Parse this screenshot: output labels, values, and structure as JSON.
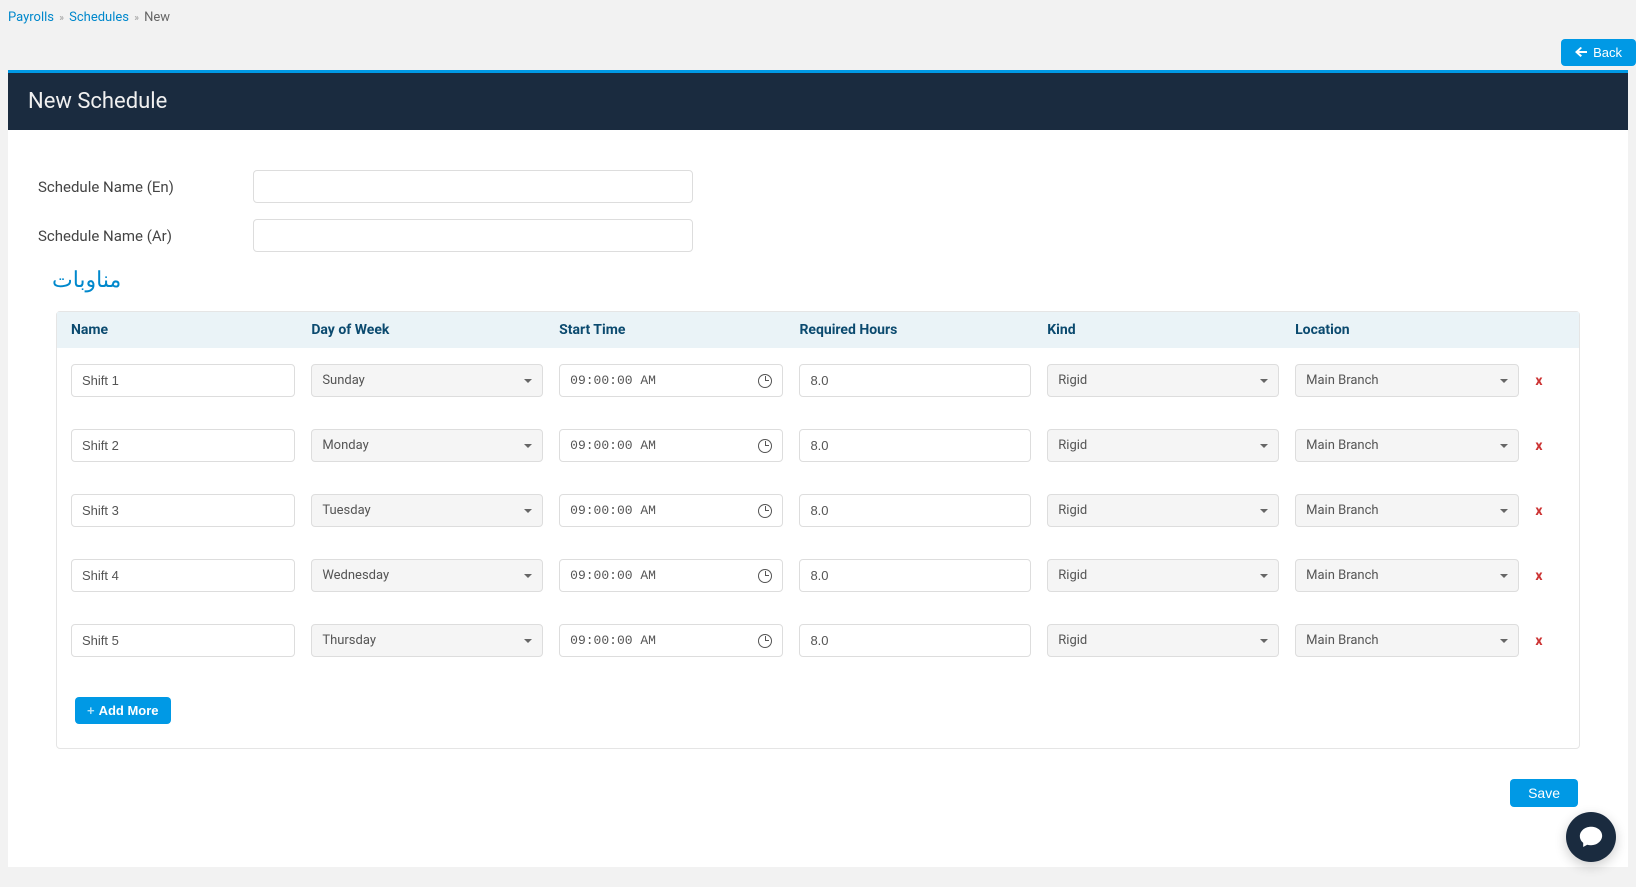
{
  "breadcrumb": {
    "payrolls": "Payrolls",
    "schedules": "Schedules",
    "current": "New"
  },
  "header": {
    "back": "Back",
    "title": "New Schedule"
  },
  "form": {
    "name_en_label": "Schedule Name (En)",
    "name_en_value": "",
    "name_ar_label": "Schedule Name (Ar)",
    "name_ar_value": "",
    "section_title": "مناوبات"
  },
  "table": {
    "headers": {
      "name": "Name",
      "day": "Day of Week",
      "start": "Start Time",
      "hours": "Required Hours",
      "kind": "Kind",
      "location": "Location"
    },
    "rows": [
      {
        "name": "Shift 1",
        "day": "Sunday",
        "start": "09:00:00 AM",
        "hours": "8.0",
        "kind": "Rigid",
        "location": "Main Branch"
      },
      {
        "name": "Shift 2",
        "day": "Monday",
        "start": "09:00:00 AM",
        "hours": "8.0",
        "kind": "Rigid",
        "location": "Main Branch"
      },
      {
        "name": "Shift 3",
        "day": "Tuesday",
        "start": "09:00:00 AM",
        "hours": "8.0",
        "kind": "Rigid",
        "location": "Main Branch"
      },
      {
        "name": "Shift 4",
        "day": "Wednesday",
        "start": "09:00:00 AM",
        "hours": "8.0",
        "kind": "Rigid",
        "location": "Main Branch"
      },
      {
        "name": "Shift 5",
        "day": "Thursday",
        "start": "09:00:00 AM",
        "hours": "8.0",
        "kind": "Rigid",
        "location": "Main Branch"
      }
    ],
    "delete_label": "x",
    "add_more": "Add More"
  },
  "actions": {
    "save": "Save"
  }
}
